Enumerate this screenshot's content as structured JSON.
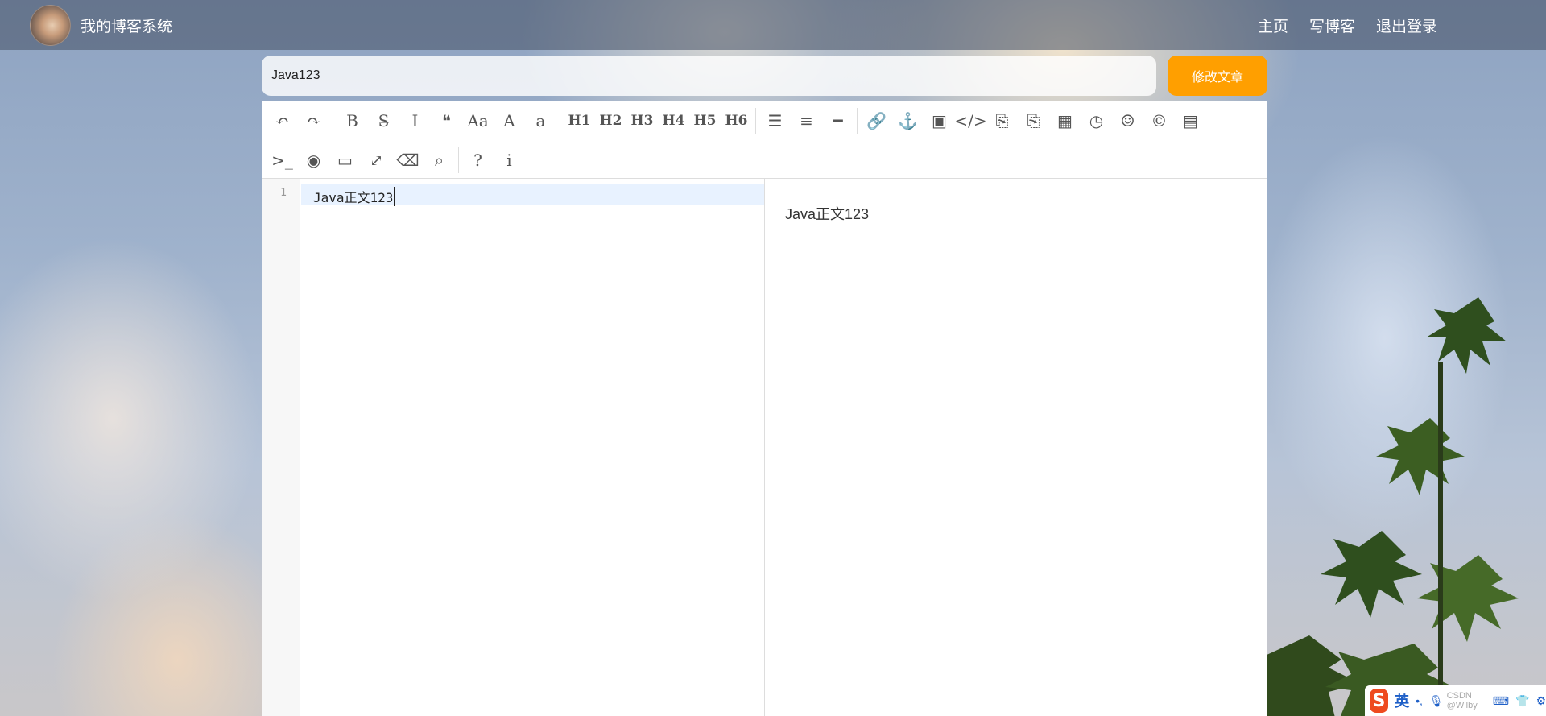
{
  "nav": {
    "site_title": "我的博客系统",
    "links": [
      "主页",
      "写博客",
      "退出登录"
    ]
  },
  "editor": {
    "title_value": "Java123",
    "submit_label": "修改文章",
    "line_number": "1",
    "content": "Java正文123",
    "preview": "Java正文123"
  },
  "toolbar": {
    "row1": [
      {
        "name": "undo-icon",
        "glyph": "↶"
      },
      {
        "name": "redo-icon",
        "glyph": "↷"
      },
      {
        "sep": true
      },
      {
        "name": "bold-icon",
        "glyph": "B"
      },
      {
        "name": "strikethrough-icon",
        "glyph": "S̶"
      },
      {
        "name": "italic-icon",
        "glyph": "I"
      },
      {
        "name": "quote-icon",
        "glyph": "❝"
      },
      {
        "name": "uppercase-icon",
        "glyph": "Aa"
      },
      {
        "name": "font-uppercase-icon",
        "glyph": "A"
      },
      {
        "name": "font-lowercase-icon",
        "glyph": "a"
      },
      {
        "sep": true
      },
      {
        "name": "h1-icon",
        "glyph": "H1",
        "h": true
      },
      {
        "name": "h2-icon",
        "glyph": "H2",
        "h": true
      },
      {
        "name": "h3-icon",
        "glyph": "H3",
        "h": true
      },
      {
        "name": "h4-icon",
        "glyph": "H4",
        "h": true
      },
      {
        "name": "h5-icon",
        "glyph": "H5",
        "h": true
      },
      {
        "name": "h6-icon",
        "glyph": "H6",
        "h": true
      },
      {
        "sep": true
      },
      {
        "name": "unordered-list-icon",
        "glyph": "☰"
      },
      {
        "name": "ordered-list-icon",
        "glyph": "≡"
      },
      {
        "name": "horizontal-rule-icon",
        "glyph": "━"
      },
      {
        "sep": true
      },
      {
        "name": "link-icon",
        "glyph": "🔗"
      },
      {
        "name": "anchor-icon",
        "glyph": "⚓"
      },
      {
        "name": "image-icon",
        "glyph": "▣"
      },
      {
        "name": "code-icon",
        "glyph": "</>"
      },
      {
        "name": "preformatted-text-icon",
        "glyph": "⎘"
      },
      {
        "name": "code-block-icon",
        "glyph": "⎘"
      },
      {
        "name": "table-icon",
        "glyph": "▦"
      },
      {
        "name": "datetime-icon",
        "glyph": "◷"
      },
      {
        "name": "emoji-icon",
        "glyph": "☺"
      },
      {
        "name": "html-entities-icon",
        "glyph": "©"
      },
      {
        "name": "pagebreak-icon",
        "glyph": "▤"
      }
    ],
    "row2": [
      {
        "name": "goto-line-icon",
        "glyph": ">_"
      },
      {
        "name": "watch-icon",
        "glyph": "◉"
      },
      {
        "name": "preview-icon",
        "glyph": "▭"
      },
      {
        "name": "fullscreen-icon",
        "glyph": "⤢"
      },
      {
        "name": "clear-icon",
        "glyph": "⌫"
      },
      {
        "name": "search-icon",
        "glyph": "⌕"
      },
      {
        "sep": true
      },
      {
        "name": "help-icon",
        "glyph": "?"
      },
      {
        "name": "info-icon",
        "glyph": "i"
      }
    ]
  },
  "ime": {
    "lang": "英",
    "watermark": "CSDN @Wllby"
  }
}
